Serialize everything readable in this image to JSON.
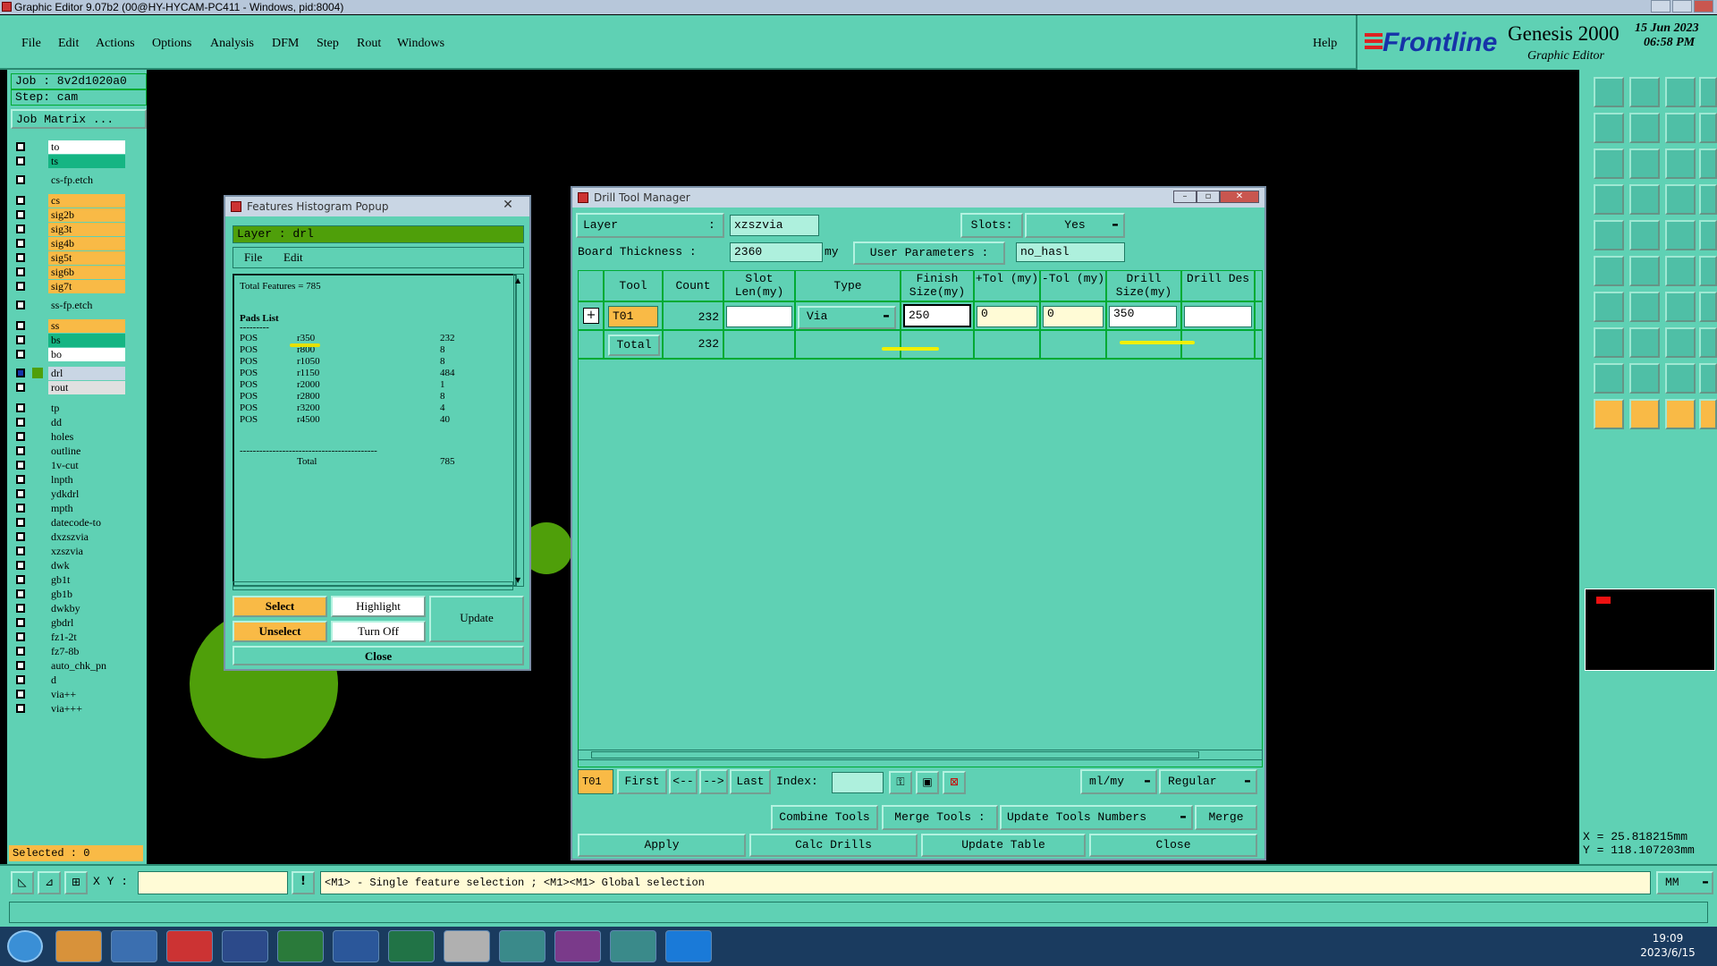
{
  "app": {
    "window_title": "Graphic Editor 9.07b2 (00@HY-HYCAM-PC411 - Windows, pid:8004)",
    "brand": "Frontline",
    "product": "Genesis 2000",
    "subtitle": "Graphic Editor",
    "date": "15 Jun 2023",
    "time": "06:58 PM"
  },
  "menu": [
    "File",
    "Edit",
    "Actions",
    "Options",
    "Analysis",
    "DFM",
    "Step",
    "Rout",
    "Windows"
  ],
  "menu_help": "Help",
  "job": {
    "job_line": "Job : 8v2d1020a0",
    "step_line": "Step: cam",
    "matrix_button": "Job Matrix ..."
  },
  "layers": [
    {
      "name": "to",
      "color": "#ffffff"
    },
    {
      "name": "ts",
      "color": "#15b583"
    },
    {
      "name": "cs-fp.etch",
      "color": "#5fd1b4"
    },
    {
      "name": "cs",
      "color": "#f9ba46"
    },
    {
      "name": "sig2b",
      "color": "#f9ba46"
    },
    {
      "name": "sig3t",
      "color": "#f9ba46"
    },
    {
      "name": "sig4b",
      "color": "#f9ba46"
    },
    {
      "name": "sig5t",
      "color": "#f9ba46"
    },
    {
      "name": "sig6b",
      "color": "#f9ba46"
    },
    {
      "name": "sig7t",
      "color": "#f9ba46"
    },
    {
      "name": "ss-fp.etch",
      "color": "#5fd1b4"
    },
    {
      "name": "ss",
      "color": "#f9ba46"
    },
    {
      "name": "bs",
      "color": "#15b583"
    },
    {
      "name": "bo",
      "color": "#ffffff"
    },
    {
      "name": "drl",
      "color": "#c9d6e4"
    },
    {
      "name": "rout",
      "color": "#e0e0e0"
    },
    {
      "name": "tp",
      "color": "#5fd1b4"
    },
    {
      "name": "dd",
      "color": "#5fd1b4"
    },
    {
      "name": "holes",
      "color": "#5fd1b4"
    },
    {
      "name": "outline",
      "color": "#5fd1b4"
    },
    {
      "name": "1v-cut",
      "color": "#5fd1b4"
    },
    {
      "name": "lnpth",
      "color": "#5fd1b4"
    },
    {
      "name": "ydkdrl",
      "color": "#5fd1b4"
    },
    {
      "name": "mpth",
      "color": "#5fd1b4"
    },
    {
      "name": "datecode-to",
      "color": "#5fd1b4"
    },
    {
      "name": "dxzszvia",
      "color": "#5fd1b4"
    },
    {
      "name": "xzszvia",
      "color": "#5fd1b4"
    },
    {
      "name": "dwk",
      "color": "#5fd1b4"
    },
    {
      "name": "gb1t",
      "color": "#5fd1b4"
    },
    {
      "name": "gb1b",
      "color": "#5fd1b4"
    },
    {
      "name": "dwkby",
      "color": "#5fd1b4"
    },
    {
      "name": "gbdrl",
      "color": "#5fd1b4"
    },
    {
      "name": "fz1-2t",
      "color": "#5fd1b4"
    },
    {
      "name": "fz7-8b",
      "color": "#5fd1b4"
    },
    {
      "name": "auto_chk_pn",
      "color": "#5fd1b4"
    },
    {
      "name": "d",
      "color": "#5fd1b4"
    },
    {
      "name": "via++",
      "color": "#5fd1b4"
    },
    {
      "name": "via+++",
      "color": "#5fd1b4"
    }
  ],
  "selected": "Selected : 0",
  "histogram": {
    "title": "Features Histogram Popup",
    "layer": "Layer :  drl",
    "menu": [
      "File",
      "Edit"
    ],
    "total_features": "Total Features = 785",
    "pads_list": "Pads List",
    "underline": "---------",
    "rows": [
      {
        "type": "POS",
        "sym": "r350",
        "count": "232"
      },
      {
        "type": "POS",
        "sym": "r800",
        "count": "8"
      },
      {
        "type": "POS",
        "sym": "r1050",
        "count": "8"
      },
      {
        "type": "POS",
        "sym": "r1150",
        "count": "484"
      },
      {
        "type": "POS",
        "sym": "r2000",
        "count": "1"
      },
      {
        "type": "POS",
        "sym": "r2800",
        "count": "8"
      },
      {
        "type": "POS",
        "sym": "r3200",
        "count": "4"
      },
      {
        "type": "POS",
        "sym": "r4500",
        "count": "40"
      }
    ],
    "separator": "------------------------------------------",
    "total_label": "Total",
    "total_value": "785",
    "buttons": {
      "select": "Select",
      "highlight": "Highlight",
      "update": "Update",
      "unselect": "Unselect",
      "turn_off": "Turn Off",
      "close": "Close"
    }
  },
  "drill": {
    "title": "Drill Tool Manager",
    "layer_label": "Layer",
    "layer_colon": ":",
    "layer_value": "xzszvia",
    "slots_label": "Slots:",
    "slots_value": "Yes",
    "thickness_label": "Board Thickness  :",
    "thickness_value": "2360",
    "thickness_unit": "my",
    "user_params_label": "User Parameters :",
    "user_params_value": "no_hasl",
    "headers": [
      "Tool",
      "Count",
      "Slot Len(my)",
      "Type",
      "Finish Size(my)",
      "+Tol (my)",
      "-Tol (my)",
      "Drill Size(my)",
      "Drill Des"
    ],
    "row": {
      "tool": "T01",
      "count": "232",
      "slot_len": "",
      "type": "Via",
      "finish": "250",
      "ptol": "0",
      "ntol": "0",
      "drill": "350",
      "des": ""
    },
    "total_label": "Total",
    "total_count": "232",
    "nav": {
      "current": "T01",
      "first": "First",
      "prev": "<--",
      "next": "-->",
      "last": "Last",
      "index_label": "Index:",
      "units": "ml/my",
      "mode": "Regular"
    },
    "actions": {
      "combine": "Combine Tools",
      "merge_tools": "Merge Tools :",
      "update_numbers": "Update Tools Numbers",
      "merge": "Merge"
    },
    "footer": {
      "apply": "Apply",
      "calc": "Calc Drills",
      "update": "Update Table",
      "close": "Close"
    }
  },
  "coords": {
    "x": "X = 25.818215mm",
    "y": "Y = 118.107203mm"
  },
  "statusbar": {
    "xy_label": "X Y :",
    "hint": "<M1> - Single feature selection ; <M1><M1> Global selection",
    "units": "MM"
  },
  "clock": {
    "time": "19:09",
    "date": "2023/6/15"
  }
}
